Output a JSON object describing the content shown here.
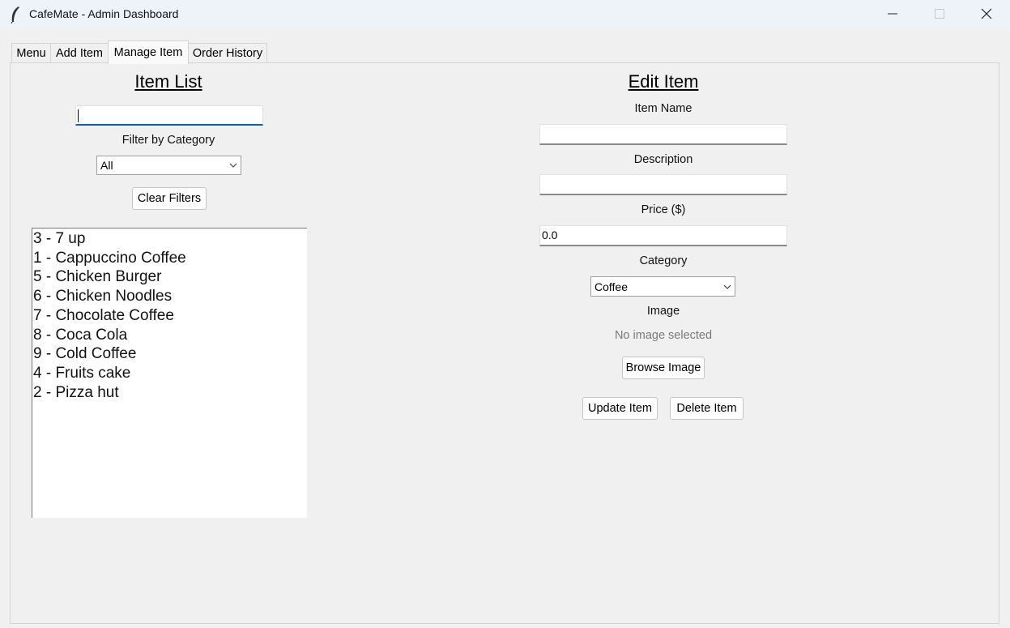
{
  "window": {
    "title": "CafeMate - Admin Dashboard"
  },
  "tabs": [
    {
      "label": "Menu"
    },
    {
      "label": "Add Item"
    },
    {
      "label": "Manage Item",
      "active": true
    },
    {
      "label": "Order History"
    }
  ],
  "item_list": {
    "heading": "Item List",
    "search_value": "",
    "filter_label": "Filter by Category",
    "filter_selected": "All",
    "clear_button": "Clear Filters",
    "items": [
      "3 - 7 up",
      "1 - Cappuccino Coffee",
      "5 - Chicken Burger",
      "6 - Chicken Noodles",
      "7 - Chocolate Coffee",
      "8 - Coca Cola",
      "9 - Cold Coffee",
      "4 - Fruits cake",
      "2 - Pizza hut"
    ]
  },
  "edit_item": {
    "heading": "Edit Item",
    "name_label": "Item Name",
    "name_value": "",
    "description_label": "Description",
    "description_value": "",
    "price_label": "Price ($)",
    "price_value": "0.0",
    "category_label": "Category",
    "category_selected": "Coffee",
    "image_label": "Image",
    "image_status": "No image selected",
    "browse_button": "Browse Image",
    "update_button": "Update Item",
    "delete_button": "Delete Item"
  },
  "colors": {
    "titlebar": "#eef3f9",
    "background": "#f0f0f0",
    "focus_accent": "#0b5fad"
  },
  "icons": {
    "app": "feather-icon",
    "minimize": "minimize-icon",
    "maximize": "maximize-icon",
    "close": "close-icon",
    "dropdown": "chevron-down-icon"
  }
}
